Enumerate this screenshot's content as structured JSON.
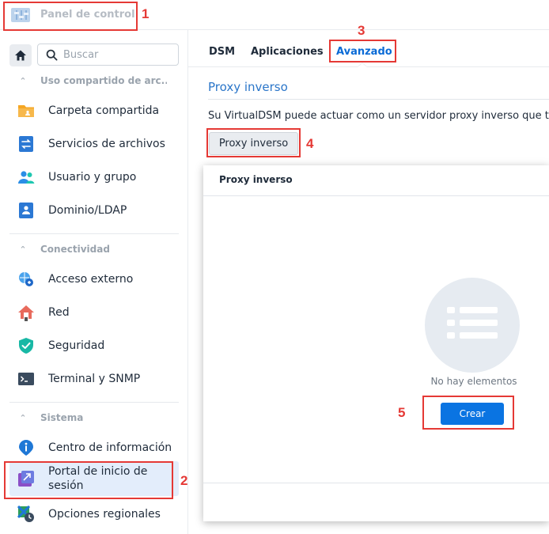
{
  "window": {
    "title": "Panel de control"
  },
  "sidebar": {
    "search_placeholder": "Buscar",
    "sections": [
      {
        "label": "Uso compartido de arc...",
        "items": [
          {
            "label": "Carpeta compartida",
            "icon": "folder-icon"
          },
          {
            "label": "Servicios de archivos",
            "icon": "file-services-icon"
          },
          {
            "label": "Usuario y grupo",
            "icon": "user-group-icon"
          },
          {
            "label": "Dominio/LDAP",
            "icon": "domain-ldap-icon"
          }
        ]
      },
      {
        "label": "Conectividad",
        "items": [
          {
            "label": "Acceso externo",
            "icon": "external-access-icon"
          },
          {
            "label": "Red",
            "icon": "network-house-icon"
          },
          {
            "label": "Seguridad",
            "icon": "shield-icon"
          },
          {
            "label": "Terminal y SNMP",
            "icon": "terminal-icon"
          }
        ]
      },
      {
        "label": "Sistema",
        "items": [
          {
            "label": "Centro de información",
            "icon": "info-icon"
          },
          {
            "label": "Portal de inicio de sesión",
            "icon": "login-portal-icon"
          },
          {
            "label": "Opciones regionales",
            "icon": "regional-options-icon"
          }
        ]
      }
    ]
  },
  "tabs": [
    {
      "label": "DSM"
    },
    {
      "label": "Aplicaciones"
    },
    {
      "label": "Avanzado"
    }
  ],
  "main": {
    "section_title": "Proxy inverso",
    "description": "Su VirtualDSM puede actuar como un servidor proxy inverso que t",
    "proxy_button": "Proxy inverso"
  },
  "modal": {
    "title": "Proxy inverso",
    "empty_text": "No hay elementos",
    "create_button": "Crear"
  },
  "annotations": [
    "1",
    "2",
    "3",
    "4",
    "5"
  ],
  "colors": {
    "accent": "#0a74e2",
    "annotation": "#e53935",
    "active_bg": "#e3edfb"
  }
}
